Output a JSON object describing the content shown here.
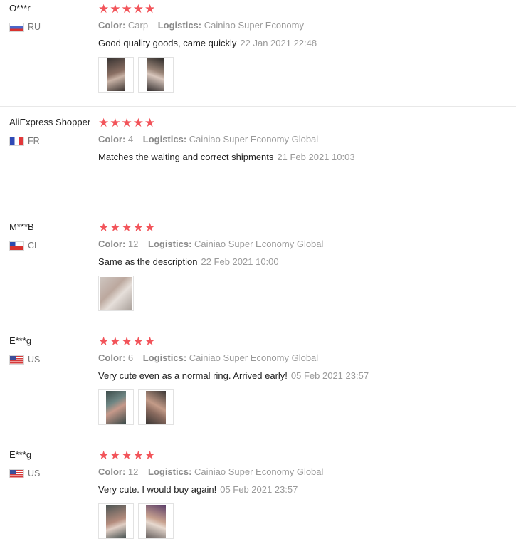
{
  "colors": {
    "star": "#f2545a",
    "meta": "#999999",
    "text": "#222222",
    "divider": "#e8e8e8"
  },
  "reviews": [
    {
      "name": "O***r",
      "flag": "ru-flag-icon",
      "country": "RU",
      "stars": "★★★★★",
      "color_label": "Color:",
      "color": "Carp",
      "logistics_label": "Logistics:",
      "logistics": "Cainiao Super Economy",
      "text": "Good quality goods, came quickly",
      "date": "22 Jan 2021 22:48",
      "photos": 2
    },
    {
      "name": "AliExpress Shopper",
      "flag": "fr-flag-icon",
      "country": "FR",
      "stars": "★★★★★",
      "color_label": "Color:",
      "color": "4",
      "logistics_label": "Logistics:",
      "logistics": "Cainiao Super Economy Global",
      "text": "Matches the waiting and correct shipments",
      "date": "21 Feb 2021 10:03",
      "photos": 0
    },
    {
      "name": "M***B",
      "flag": "cl-flag-icon",
      "country": "CL",
      "stars": "★★★★★",
      "color_label": "Color:",
      "color": "12",
      "logistics_label": "Logistics:",
      "logistics": "Cainiao Super Economy Global",
      "text": "Same as the description",
      "date": "22 Feb 2021 10:00",
      "photos": 1
    },
    {
      "name": "E***g",
      "flag": "us-flag-icon",
      "country": "US",
      "stars": "★★★★★",
      "color_label": "Color:",
      "color": "6",
      "logistics_label": "Logistics:",
      "logistics": "Cainiao Super Economy Global",
      "text": "Very cute even as a normal ring. Arrived early!",
      "date": "05 Feb 2021 23:57",
      "photos": 2
    },
    {
      "name": "E***g",
      "flag": "us-flag-icon",
      "country": "US",
      "stars": "★★★★★",
      "color_label": "Color:",
      "color": "12",
      "logistics_label": "Logistics:",
      "logistics": "Cainiao Super Economy Global",
      "text": "Very cute. I would buy again!",
      "date": "05 Feb 2021 23:57",
      "photos": 2
    }
  ]
}
